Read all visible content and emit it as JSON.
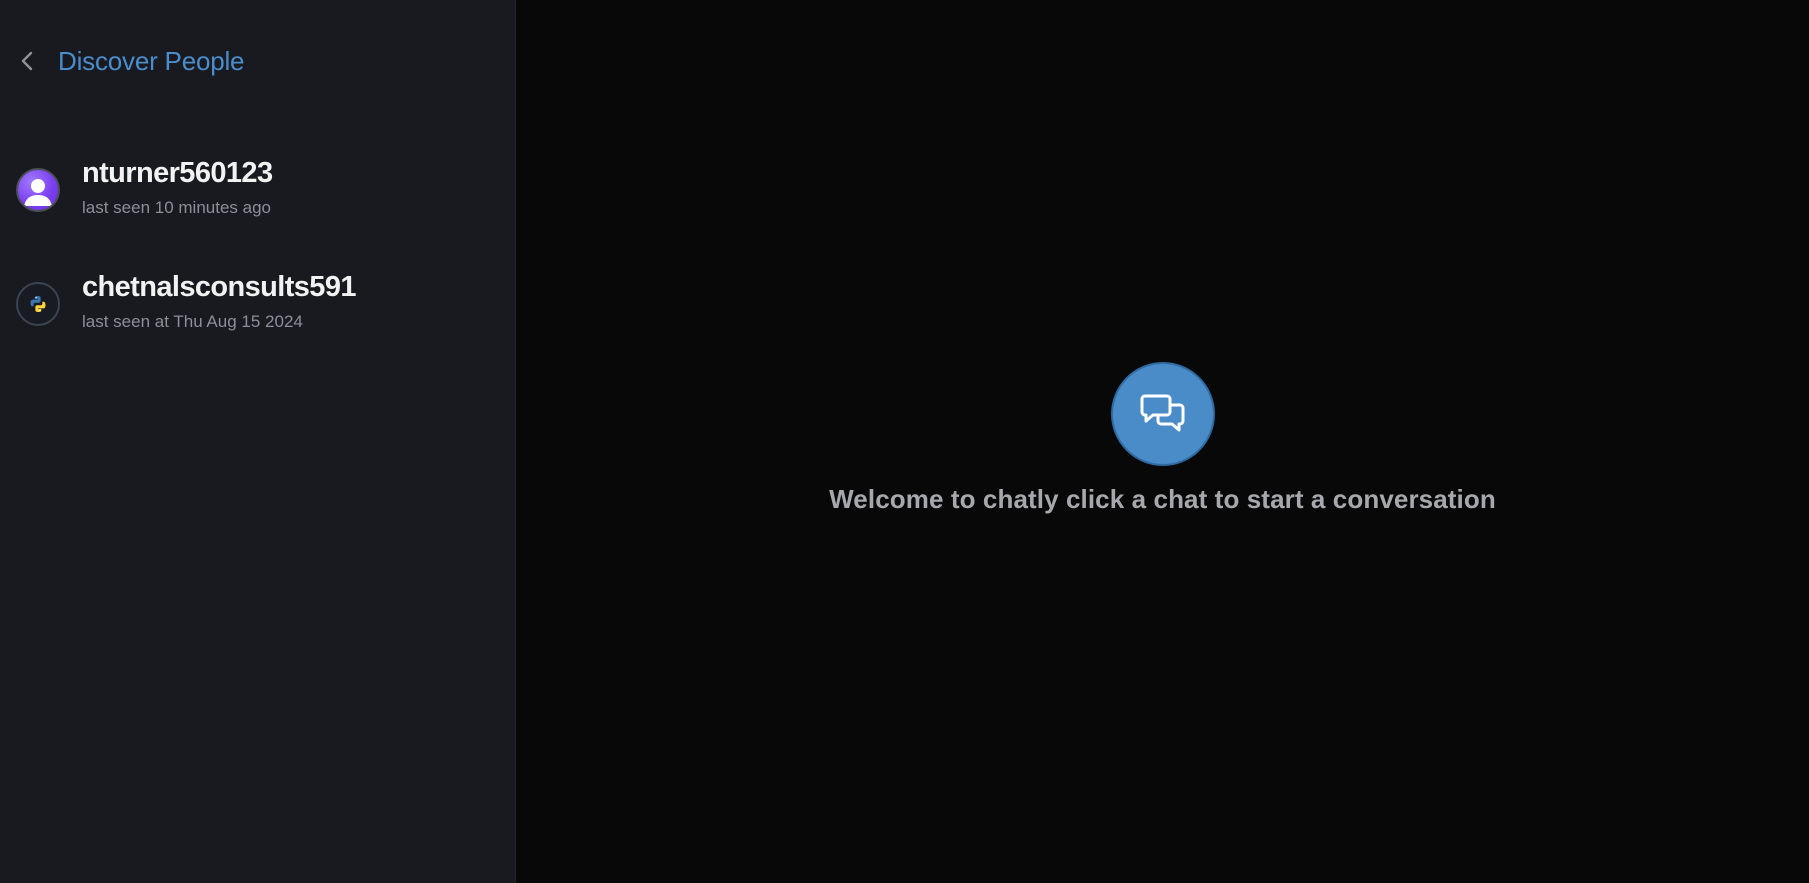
{
  "sidebar": {
    "title": "Discover People",
    "back_icon": "chevron-left-icon",
    "people": [
      {
        "username": "nturner560123",
        "status": "last seen 10 minutes ago",
        "avatar": "default-user-avatar"
      },
      {
        "username": "chetnalsconsults591",
        "status": "last seen at Thu Aug 15 2024",
        "avatar": "python-logo-avatar"
      }
    ]
  },
  "main": {
    "icon": "chat-bubbles-icon",
    "welcome_text": "Welcome to chatly click a chat to start a conversation"
  },
  "colors": {
    "accent": "#4a8cc8",
    "sidebar_bg": "#181a1f",
    "main_bg": "#080808",
    "avatar_purple": "#7c3ff0"
  }
}
